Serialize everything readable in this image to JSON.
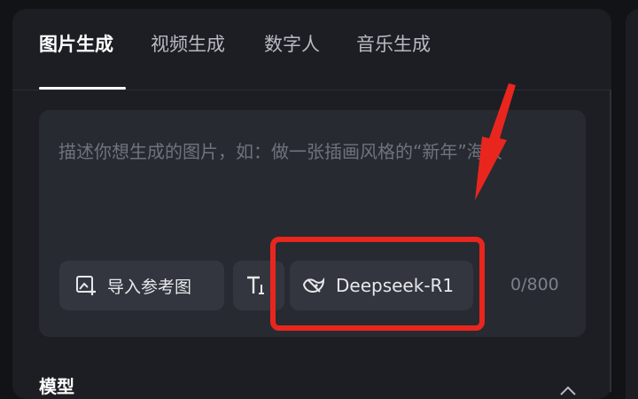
{
  "tabs": [
    {
      "label": "图片生成",
      "active": true
    },
    {
      "label": "视频生成",
      "active": false
    },
    {
      "label": "数字人",
      "active": false
    },
    {
      "label": "音乐生成",
      "active": false
    }
  ],
  "prompt": {
    "placeholder": "描述你想生成的图片，如：做一张插画风格的“新年”海报",
    "value": ""
  },
  "toolbar": {
    "import_label": "导入参考图",
    "text_icon_label": "T",
    "model_label": "Deepseek-R1",
    "counter": "0/800"
  },
  "section": {
    "title": "模型"
  },
  "colors": {
    "accent_highlight": "#e8261e",
    "panel": "#1c1e24",
    "input_box": "#272a31"
  }
}
